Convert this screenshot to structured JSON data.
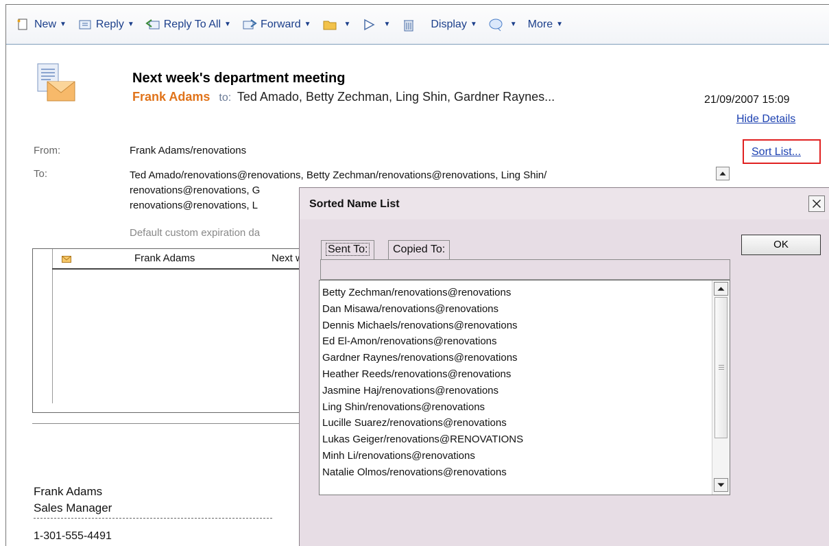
{
  "toolbar": {
    "new": "New",
    "reply": "Reply",
    "reply_all": "Reply To All",
    "forward": "Forward",
    "display": "Display",
    "more": "More"
  },
  "message": {
    "subject": "Next week's department meeting",
    "from_name": "Frank Adams",
    "to_word": "to:",
    "recipients_summary": "Ted Amado, Betty Zechman, Ling Shin, Gardner Raynes...",
    "date": "21/09/2007 15:09",
    "hide_details": "Hide Details",
    "from_label": "From:",
    "from_value": "Frank Adams/renovations",
    "to_label": "To:",
    "to_line1": "Ted Amado/renovations@renovations, Betty Zechman/renovations@renovations, Ling Shin/",
    "to_line2": "renovations@renovations, G",
    "to_line3": "renovations@renovations, L",
    "expiry": "Default custom expiration da",
    "sort_list": "Sort List..."
  },
  "thread": {
    "from": "Frank Adams",
    "subject": "Next w"
  },
  "signature": {
    "name": "Frank Adams",
    "title": "Sales Manager",
    "phone": "1-301-555-4491"
  },
  "dialog": {
    "title": "Sorted Name List",
    "ok": "OK",
    "tab_sent": "Sent To:",
    "tab_copied": "Copied To:",
    "names": [
      "Betty Zechman/renovations@renovations",
      "Dan Misawa/renovations@renovations",
      "Dennis Michaels/renovations@renovations",
      "Ed El-Amon/renovations@renovations",
      "Gardner Raynes/renovations@renovations",
      "Heather Reeds/renovations@renovations",
      "Jasmine Haj/renovations@renovations",
      "Ling Shin/renovations@renovations",
      "Lucille Suarez/renovations@renovations",
      "Lukas Geiger/renovations@RENOVATIONS",
      "Minh Li/renovations@renovations",
      "Natalie Olmos/renovations@renovations"
    ]
  },
  "colors": {
    "accent_link": "#1a3fb0",
    "sender_orange": "#e0731a",
    "dialog_bg": "#e7dde5",
    "highlight_red": "#e02020"
  }
}
